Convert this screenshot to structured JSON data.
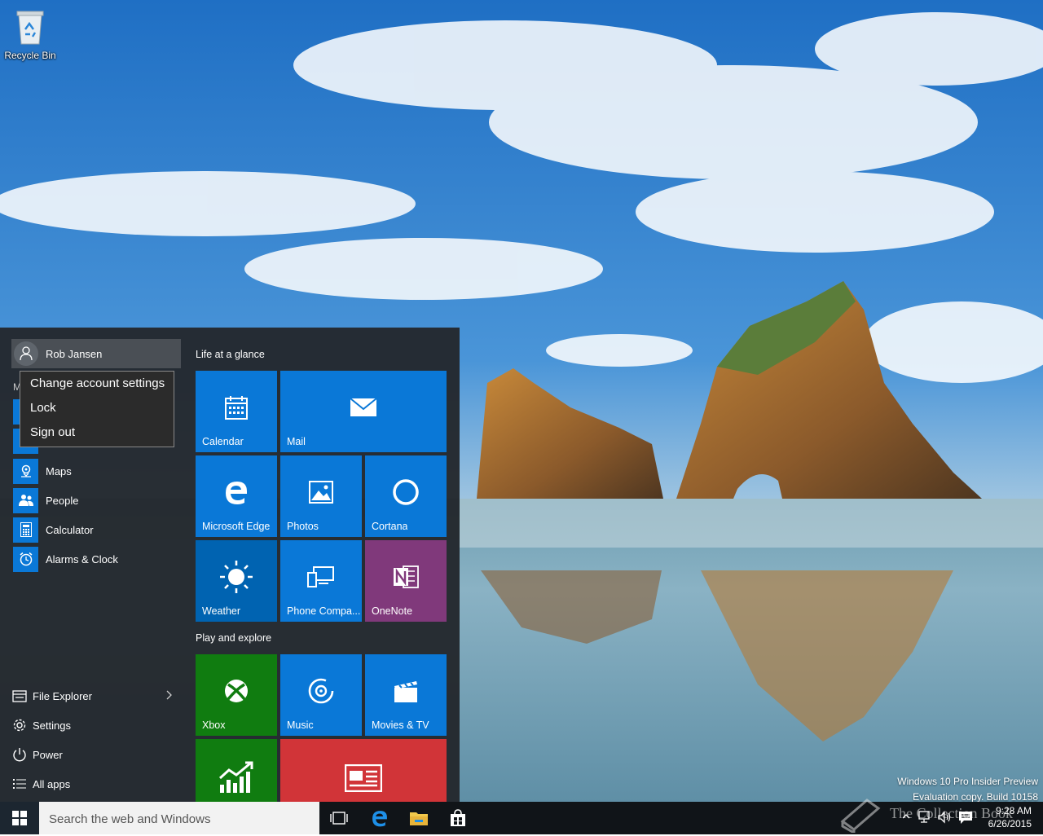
{
  "desktop": {
    "recycle_bin_label": "Recycle Bin",
    "watermark_line1": "Windows 10 Pro Insider Preview",
    "watermark_line2": "Evaluation copy. Build 10158",
    "overlay_brand": "The Collection Book"
  },
  "start_menu": {
    "user_name": "Rob Jansen",
    "account_menu": [
      "Change account settings",
      "Lock",
      "Sign out"
    ],
    "section_letter": "M",
    "apps": [
      {
        "label": "Maps",
        "icon": "maps-icon"
      },
      {
        "label": "People",
        "icon": "people-icon"
      },
      {
        "label": "Calculator",
        "icon": "calculator-icon"
      },
      {
        "label": "Alarms & Clock",
        "icon": "alarm-clock-icon"
      }
    ],
    "bottom": {
      "file_explorer": "File Explorer",
      "settings": "Settings",
      "power": "Power",
      "all_apps": "All apps"
    },
    "groups": {
      "life": "Life at a glance",
      "play": "Play and explore"
    },
    "tiles": {
      "calendar": "Calendar",
      "mail": "Mail",
      "edge": "Microsoft Edge",
      "photos": "Photos",
      "cortana": "Cortana",
      "weather": "Weather",
      "phone": "Phone Compa...",
      "onenote": "OneNote",
      "xbox": "Xbox",
      "music": "Music",
      "movies": "Movies & TV"
    },
    "colors": {
      "tile_blue": "#0a78d7",
      "weather_blue": "#0063b1",
      "onenote_purple": "#80397b",
      "xbox_green": "#107c10",
      "news_red": "#d13438"
    }
  },
  "taskbar": {
    "search_placeholder": "Search the web and Windows",
    "time": "9:28 AM",
    "date": "6/26/2015"
  }
}
